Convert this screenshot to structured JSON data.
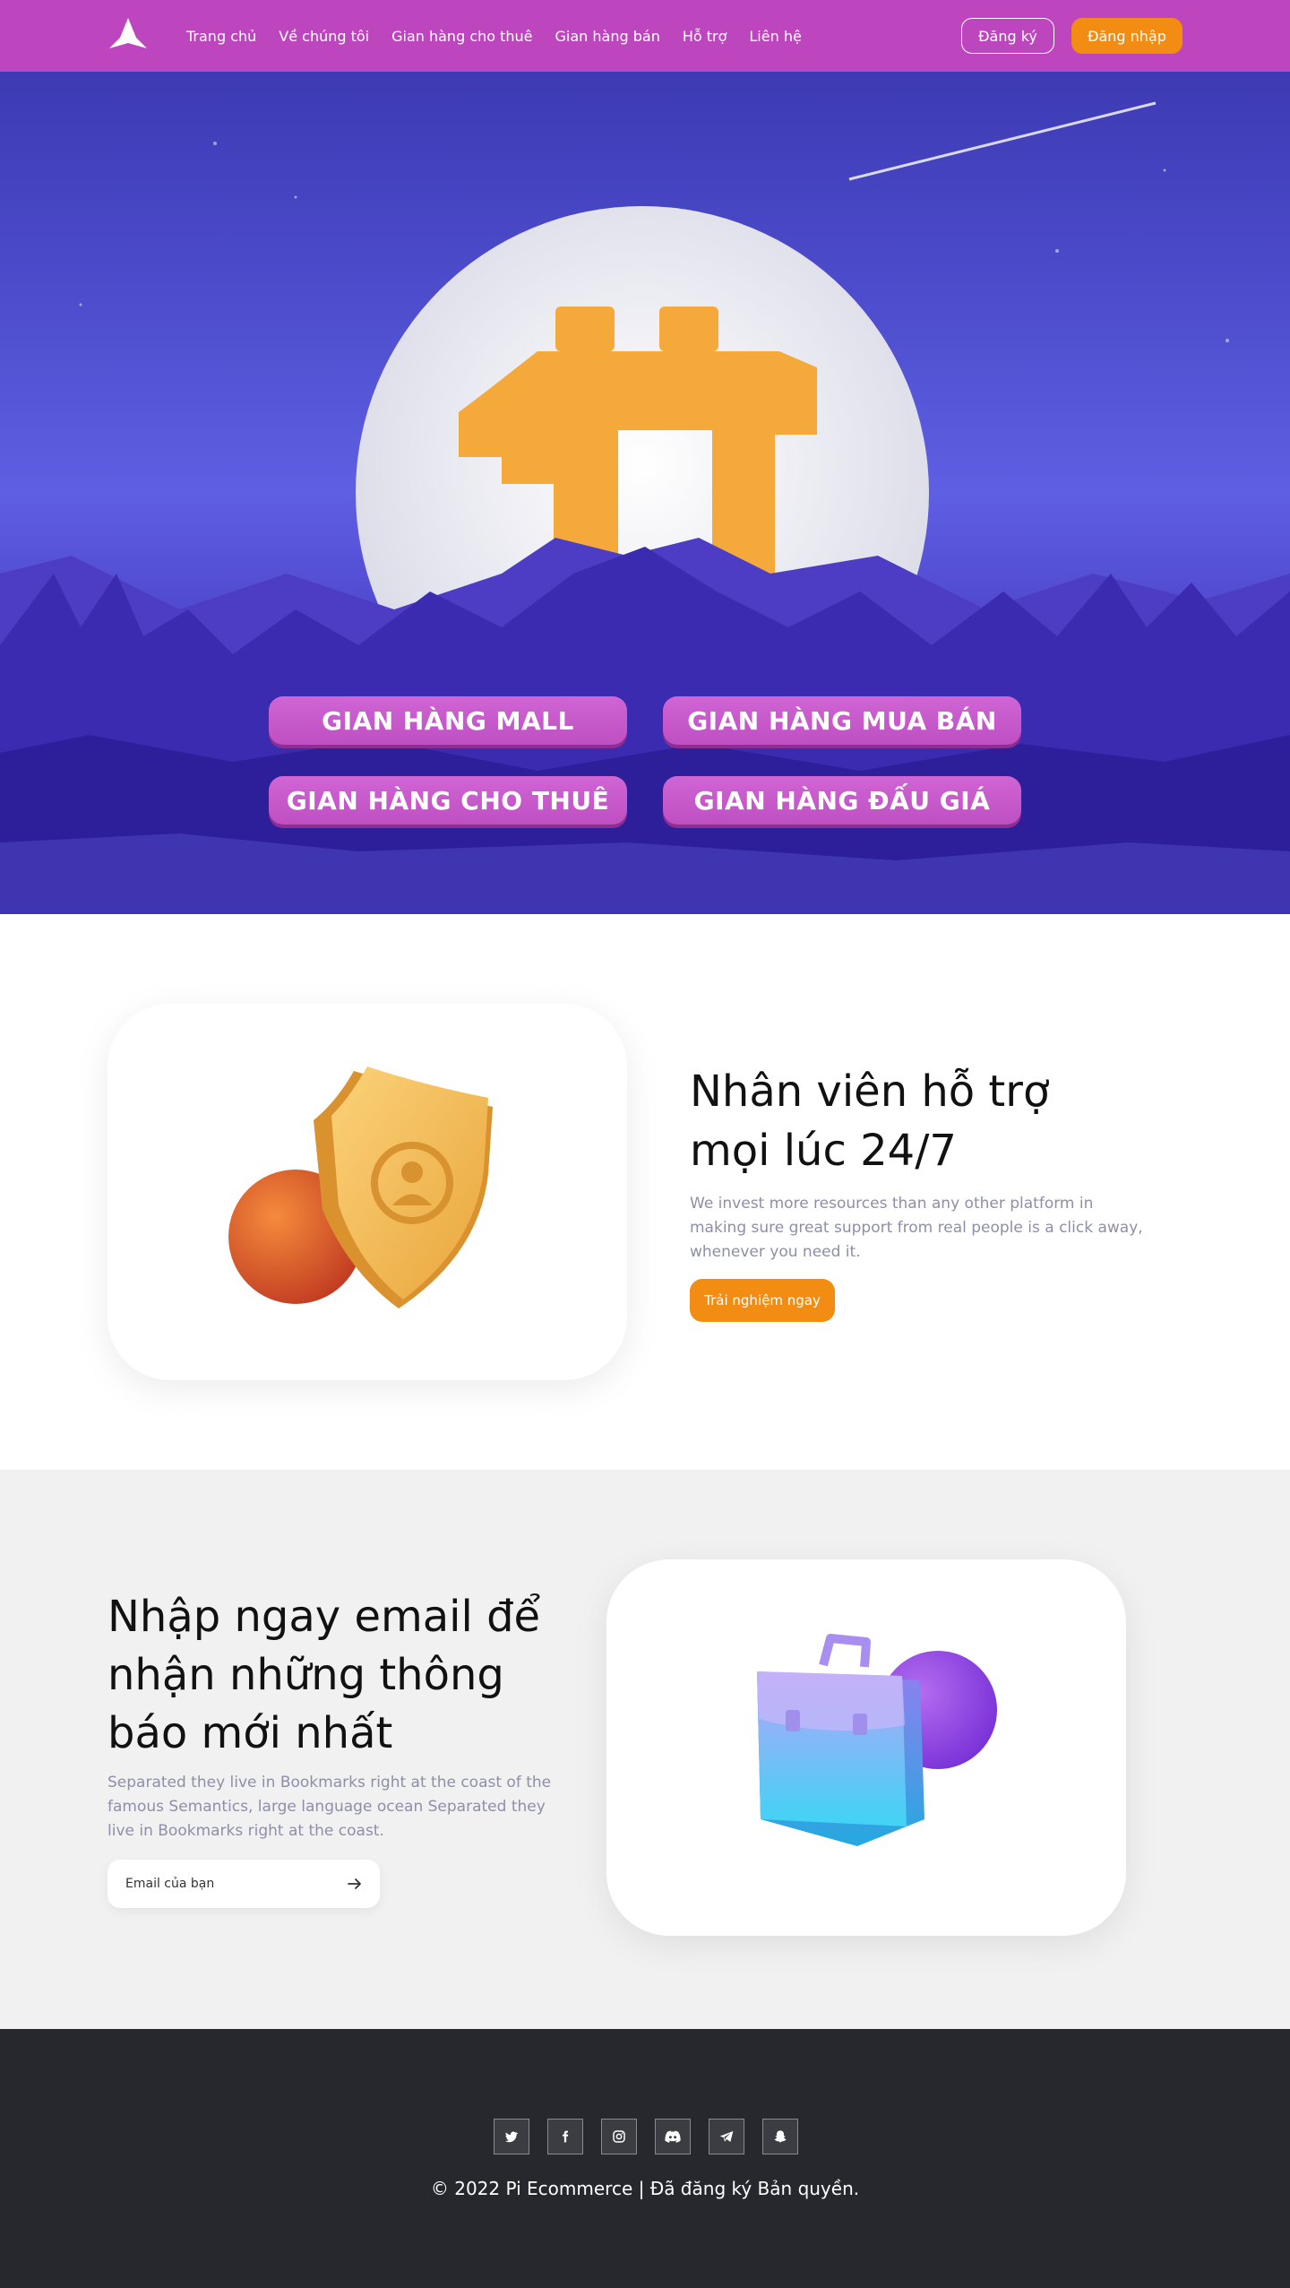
{
  "nav": {
    "menu": [
      "Trang chủ",
      "Về chúng tôi",
      "Gian hàng cho thuê",
      "Gian hàng bán",
      "Hỗ trợ",
      "Liên hệ"
    ],
    "register_label": "Đăng ký",
    "login_label": "Đăng nhập",
    "logo_icon": "pi-logo-icon"
  },
  "hero": {
    "buttons": [
      "GIAN HÀNG MALL",
      "GIAN HÀNG MUA BÁN",
      "GIAN HÀNG CHO THUÊ",
      "GIAN HÀNG ĐẤU GIÁ"
    ]
  },
  "support": {
    "title_line1": "Nhân viên hỗ trợ",
    "title_line2": "mọi lúc 24/7",
    "desc_line1": "We invest more resources than any other platform in",
    "desc_line2": "making sure great support from real people is a click away,",
    "desc_line3": "whenever you need it.",
    "cta_label": "Trải nghiệm ngay",
    "illustration_icon": "shield-icon"
  },
  "newsletter": {
    "title_line1": "Nhập ngay email để",
    "title_line2": "nhận những thông",
    "title_line3": "báo mới nhất",
    "desc_line1": "Separated they live in Bookmarks right at the coast of the",
    "desc_line2": "famous Semantics, large language ocean Separated they",
    "desc_line3": "live in Bookmarks right at the coast.",
    "email_placeholder": "Email của bạn",
    "illustration_icon": "briefcase-icon"
  },
  "footer": {
    "socials": [
      "twitter-icon",
      "facebook-icon",
      "instagram-icon",
      "discord-icon",
      "telegram-icon",
      "snapchat-icon"
    ],
    "copyright": "© 2022 Pi Ecommerce | Đã đăng ký Bản quyền."
  },
  "colors": {
    "nav_bg": "#bd45bd",
    "accent_orange": "#f28c13",
    "hero_button": "#c758cb",
    "section_gray": "#f1f1f1",
    "footer_bg": "#26282d"
  }
}
